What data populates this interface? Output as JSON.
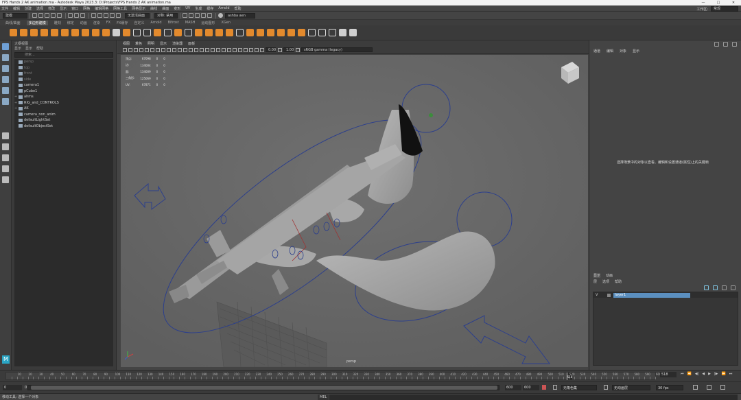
{
  "window": {
    "title": "FPS Hands 2 AK animation.ma - Autodesk Maya 2023.3: D:\\Projects\\FPS Hands 2 AK animation.ma",
    "controls": [
      "—",
      "□",
      "✕"
    ]
  },
  "menubar": [
    "文件",
    "编辑",
    "创建",
    "选择",
    "修改",
    "显示",
    "窗口",
    "网格",
    "编辑网格",
    "网格工具",
    "网格显示",
    "曲线",
    "曲面",
    "变形",
    "UV",
    "生成",
    "缓存",
    "Arnold",
    "帮助"
  ],
  "workspace": {
    "label": "工作区:",
    "value": "常规"
  },
  "statusline": {
    "mode": "建模",
    "live": "无激活曲面",
    "sym": "对称: 禁用",
    "user": "ashba aen"
  },
  "shelf_tabs": [
    "曲线/曲面",
    "多边形建模",
    "雕刻",
    "绑定",
    "动画",
    "渲染",
    "FX",
    "FX缓存",
    "自定义",
    "Arnold",
    "Bifrost",
    "MASH",
    "运动图形",
    "XGen"
  ],
  "shelf_active": "多边形建模",
  "outliner": {
    "menu": [
      "显示",
      "显示",
      "帮助"
    ],
    "search_placeholder": "搜索...",
    "items": [
      {
        "label": "persp",
        "dim": true
      },
      {
        "label": "top",
        "dim": true
      },
      {
        "label": "front",
        "dim": true
      },
      {
        "label": "side",
        "dim": true
      },
      {
        "label": "camera1",
        "dim": false
      },
      {
        "label": "pCube1",
        "dim": false
      },
      {
        "label": "ahms",
        "dim": false
      },
      {
        "label": "RIG_and_CONTROLS",
        "dim": false
      },
      {
        "label": "AK",
        "dim": false
      },
      {
        "label": "camera_non_anim",
        "dim": false
      },
      {
        "label": "defaultLightSet",
        "dim": false
      },
      {
        "label": "defaultObjectSet",
        "dim": false
      }
    ]
  },
  "viewport": {
    "menu": [
      "视图",
      "着色",
      "照明",
      "显示",
      "渲染器",
      "面板"
    ],
    "exposure": "0.00",
    "gamma": "1.00",
    "colorspace": "sRGB gamma (legacy)",
    "stats": [
      [
        "顶点:",
        "67098",
        "0",
        "0"
      ],
      [
        "边:",
        "134004",
        "0",
        "0"
      ],
      [
        "面:",
        "134009",
        "0",
        "0"
      ],
      [
        "三角形:",
        "125069",
        "0",
        "0"
      ],
      [
        "UV:",
        "67871",
        "0",
        "0"
      ]
    ],
    "camera_label": "persp"
  },
  "attribute_editor": {
    "tabs": [
      "通道",
      "编辑",
      "对象",
      "显示"
    ],
    "message": "选择场景中的对象以查看、编辑和设置通道(属性)上的关键帧"
  },
  "layer_editor": {
    "tabs": [
      "显示",
      "动画"
    ],
    "menu": [
      "层",
      "选项",
      "帮助"
    ],
    "layer": {
      "vis": "V",
      "name": "layer1"
    }
  },
  "timeline": {
    "ticks": [
      "5",
      "10",
      "15",
      "20",
      "25",
      "30",
      "35",
      "40",
      "45",
      "50",
      "55",
      "60",
      "65",
      "70",
      "75",
      "80",
      "85",
      "90",
      "95",
      "100",
      "105",
      "110",
      "115",
      "120",
      "125",
      "130",
      "135",
      "140",
      "145",
      "150",
      "155",
      "160",
      "165",
      "170",
      "175",
      "180",
      "185",
      "190",
      "195",
      "200",
      "205",
      "210",
      "215",
      "220",
      "225",
      "230",
      "235",
      "240",
      "245",
      "250",
      "255",
      "260",
      "265",
      "270",
      "275",
      "280",
      "285",
      "290",
      "295",
      "300",
      "305",
      "310",
      "315",
      "320",
      "325",
      "330",
      "335",
      "340",
      "345",
      "350",
      "355",
      "360",
      "365",
      "370",
      "375",
      "380",
      "385",
      "390",
      "395",
      "400",
      "405",
      "410",
      "415",
      "420",
      "425",
      "430",
      "435",
      "440",
      "445",
      "450",
      "455",
      "460",
      "465",
      "470",
      "475",
      "480",
      "485",
      "490",
      "495",
      "500",
      "505",
      "510",
      "515",
      "520",
      "525",
      "530",
      "535",
      "540",
      "545",
      "550",
      "555",
      "560",
      "565",
      "570",
      "575",
      "580",
      "585",
      "590",
      "595",
      "600"
    ],
    "marker": "518",
    "current_frame": "518",
    "end": "600"
  },
  "range": {
    "start": "0",
    "inner_start": "0",
    "inner_end": "600",
    "end": "600",
    "char_set": "无角色集",
    "anim_layer": "无动画层",
    "fps": "30 fps"
  },
  "cmd": {
    "lang": "MEL",
    "help": "移动工具: 选择一个对象"
  }
}
